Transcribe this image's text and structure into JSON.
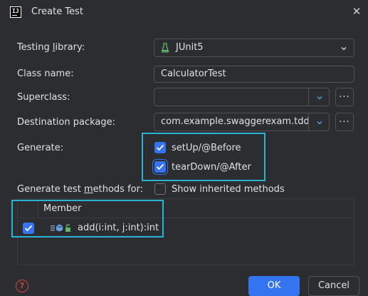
{
  "window": {
    "title": "Create Test",
    "app_icon_text": "IJ"
  },
  "form": {
    "testing_library": {
      "label_pre": "Testing ",
      "label_u": "l",
      "label_post": "ibrary:",
      "value": "JUnit5"
    },
    "class_name": {
      "label": "Class name:",
      "value": "CalculatorTest"
    },
    "superclass": {
      "label": "Superclass:",
      "value": "",
      "browse_label": "..."
    },
    "destination_package": {
      "label": "Destination package:",
      "value": "com.example.swaggerexam.tdd",
      "browse_label": "..."
    },
    "generate": {
      "label": "Generate:",
      "options": [
        {
          "label": "setUp/@Before",
          "checked": true
        },
        {
          "label": "tearDown/@After",
          "checked": true
        }
      ]
    },
    "methods": {
      "label_pre": "Generate test ",
      "label_u": "m",
      "label_post": "ethods for:",
      "show_inherited_label": "Show inherited methods",
      "show_inherited_checked": false
    }
  },
  "table": {
    "column_header": "Member",
    "rows": [
      {
        "checked": true,
        "signature": "add(i:int, j:int):int",
        "icons": [
          "method-icon",
          "package-icon",
          "unlocked-icon"
        ]
      }
    ]
  },
  "buttons": {
    "ok": "OK",
    "cancel": "Cancel",
    "help": "?"
  },
  "colors": {
    "accent": "#3574f0",
    "highlight": "#2ab3d4",
    "background": "#2b2d30",
    "junit_green": "#5fb865",
    "help_red": "#d6443d"
  }
}
